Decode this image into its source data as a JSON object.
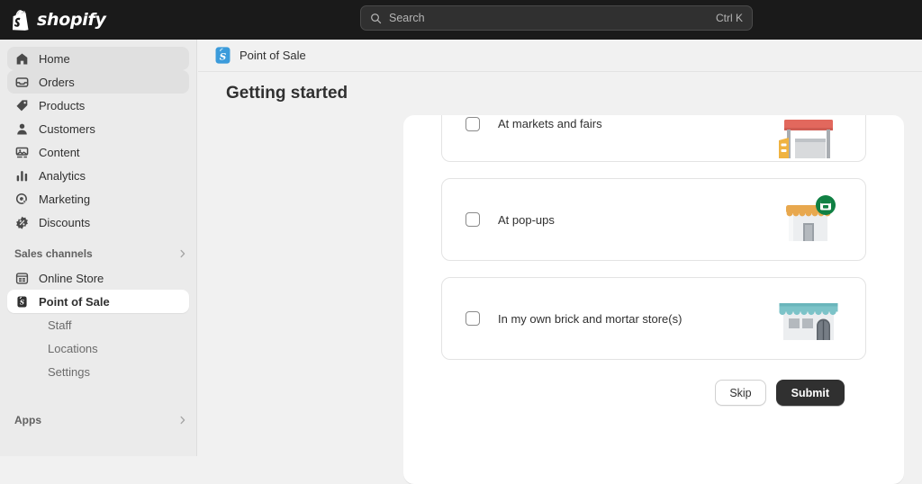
{
  "topbar": {
    "brand": "shopify",
    "brand_icon": "shopify-bag-icon",
    "search": {
      "icon": "search-icon",
      "placeholder": "Search",
      "shortcut": "Ctrl K"
    }
  },
  "sidebar": {
    "primary_items": [
      {
        "label": "Home",
        "icon": "home-icon",
        "state": "highlighted"
      },
      {
        "label": "Orders",
        "icon": "orders-inbox-icon",
        "state": "highlighted"
      },
      {
        "label": "Products",
        "icon": "products-tag-icon",
        "state": "default"
      },
      {
        "label": "Customers",
        "icon": "customers-person-icon",
        "state": "default"
      },
      {
        "label": "Content",
        "icon": "content-image-icon",
        "state": "default"
      },
      {
        "label": "Analytics",
        "icon": "analytics-bars-icon",
        "state": "default"
      },
      {
        "label": "Marketing",
        "icon": "marketing-target-icon",
        "state": "default"
      },
      {
        "label": "Discounts",
        "icon": "discounts-percent-badge-icon",
        "state": "default"
      }
    ],
    "sales_channels": {
      "label": "Sales channels",
      "chevron": "chevron-right-icon",
      "items": [
        {
          "label": "Online Store",
          "icon": "online-store-icon",
          "state": "default"
        },
        {
          "label": "Point of Sale",
          "icon": "point-of-sale-icon",
          "state": "selected"
        }
      ],
      "sub_items": [
        {
          "label": "Staff"
        },
        {
          "label": "Locations"
        },
        {
          "label": "Settings"
        }
      ]
    },
    "apps": {
      "label": "Apps",
      "chevron": "chevron-right-icon"
    }
  },
  "main": {
    "breadcrumb": {
      "icon": "shopify-pos-icon",
      "label": "Point of Sale"
    },
    "page_title": "Getting started",
    "options": [
      {
        "label": "At markets and fairs",
        "checked": false,
        "art": "market-stall-illustration",
        "clipped": true
      },
      {
        "label": "At pop-ups",
        "checked": false,
        "art": "popup-shop-illustration",
        "clipped": false
      },
      {
        "label": "In my own brick and mortar store(s)",
        "checked": false,
        "art": "brick-and-mortar-store-illustration",
        "clipped": false
      }
    ],
    "actions": {
      "skip_label": "Skip",
      "submit_label": "Submit"
    }
  },
  "colors": {
    "topbar_bg": "#1a1a1a",
    "sidebar_bg": "#ebebeb",
    "page_bg": "#f1f1f1",
    "surface_bg": "#ffffff",
    "text_primary": "#303030",
    "text_muted": "#6b6b6b",
    "submit_bg": "#303030",
    "market_canopy": "#e2685d",
    "popup_awning": "#e8a84e",
    "popup_badge": "#108043",
    "store_awning": "#7cc3c8",
    "pos_icon_blue": "#3b9bdb"
  }
}
